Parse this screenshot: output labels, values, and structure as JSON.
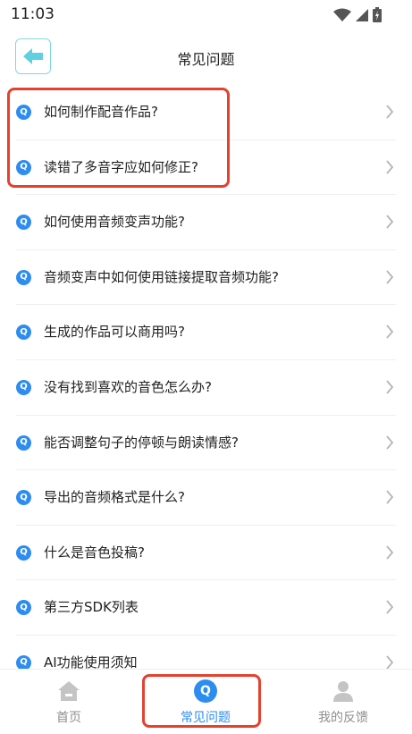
{
  "status_bar": {
    "time": "11:03"
  },
  "header": {
    "title": "常见问题"
  },
  "faq": {
    "icon_letter": "Q",
    "items": [
      {
        "text": "如何制作配音作品?"
      },
      {
        "text": "读错了多音字应如何修正?"
      },
      {
        "text": "如何使用音频变声功能?"
      },
      {
        "text": "音频变声中如何使用链接提取音频功能?"
      },
      {
        "text": "生成的作品可以商用吗?"
      },
      {
        "text": "没有找到喜欢的音色怎么办?"
      },
      {
        "text": "能否调整句子的停顿与朗读情感?"
      },
      {
        "text": "导出的音频格式是什么?"
      },
      {
        "text": "什么是音色投稿?"
      },
      {
        "text": "第三方SDK列表"
      },
      {
        "text": "AI功能使用须知"
      }
    ]
  },
  "tabs": [
    {
      "label": "首页",
      "icon": "home-icon",
      "active": false
    },
    {
      "label": "常见问题",
      "icon": "faq-icon",
      "active": true,
      "badge": "Q"
    },
    {
      "label": "我的反馈",
      "icon": "user-icon",
      "active": false
    }
  ],
  "colors": {
    "accent": "#2d8cf0",
    "highlight": "#e5412f",
    "back_border": "#7fd8e6"
  }
}
